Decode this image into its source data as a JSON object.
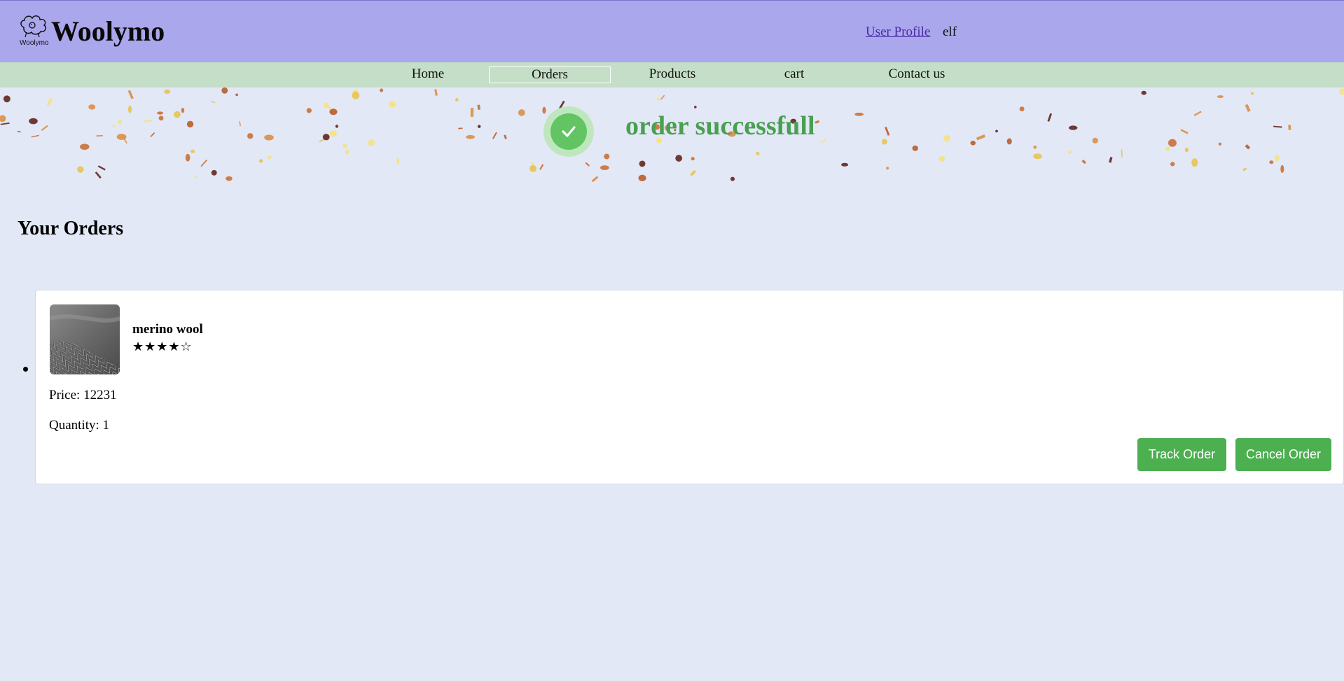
{
  "header": {
    "logo_small_text": "Woolymo",
    "brand_name": "Woolymo",
    "profile_link": "User Profile",
    "username": "elf"
  },
  "nav": {
    "items": [
      {
        "label": "Home",
        "active": false
      },
      {
        "label": "Orders",
        "active": true
      },
      {
        "label": "Products",
        "active": false
      },
      {
        "label": "cart",
        "active": false
      },
      {
        "label": "Contact us",
        "active": false
      }
    ]
  },
  "banner": {
    "message": "order successfull",
    "icon": "check-circle-icon",
    "accent_color": "#48a050"
  },
  "orders": {
    "title": "Your Orders",
    "items": [
      {
        "product_name": "merino wool",
        "rating_stars": "★★★★☆",
        "rating_value": 4,
        "rating_max": 5,
        "price_text": "Price: 12231",
        "quantity_text": "Quantity: 1",
        "track_label": "Track Order",
        "cancel_label": "Cancel Order"
      }
    ]
  },
  "colors": {
    "header_bg": "#aaa7ec",
    "nav_bg": "#c5dec7",
    "page_bg": "#e3e8f6",
    "button_bg": "#4caf50"
  }
}
